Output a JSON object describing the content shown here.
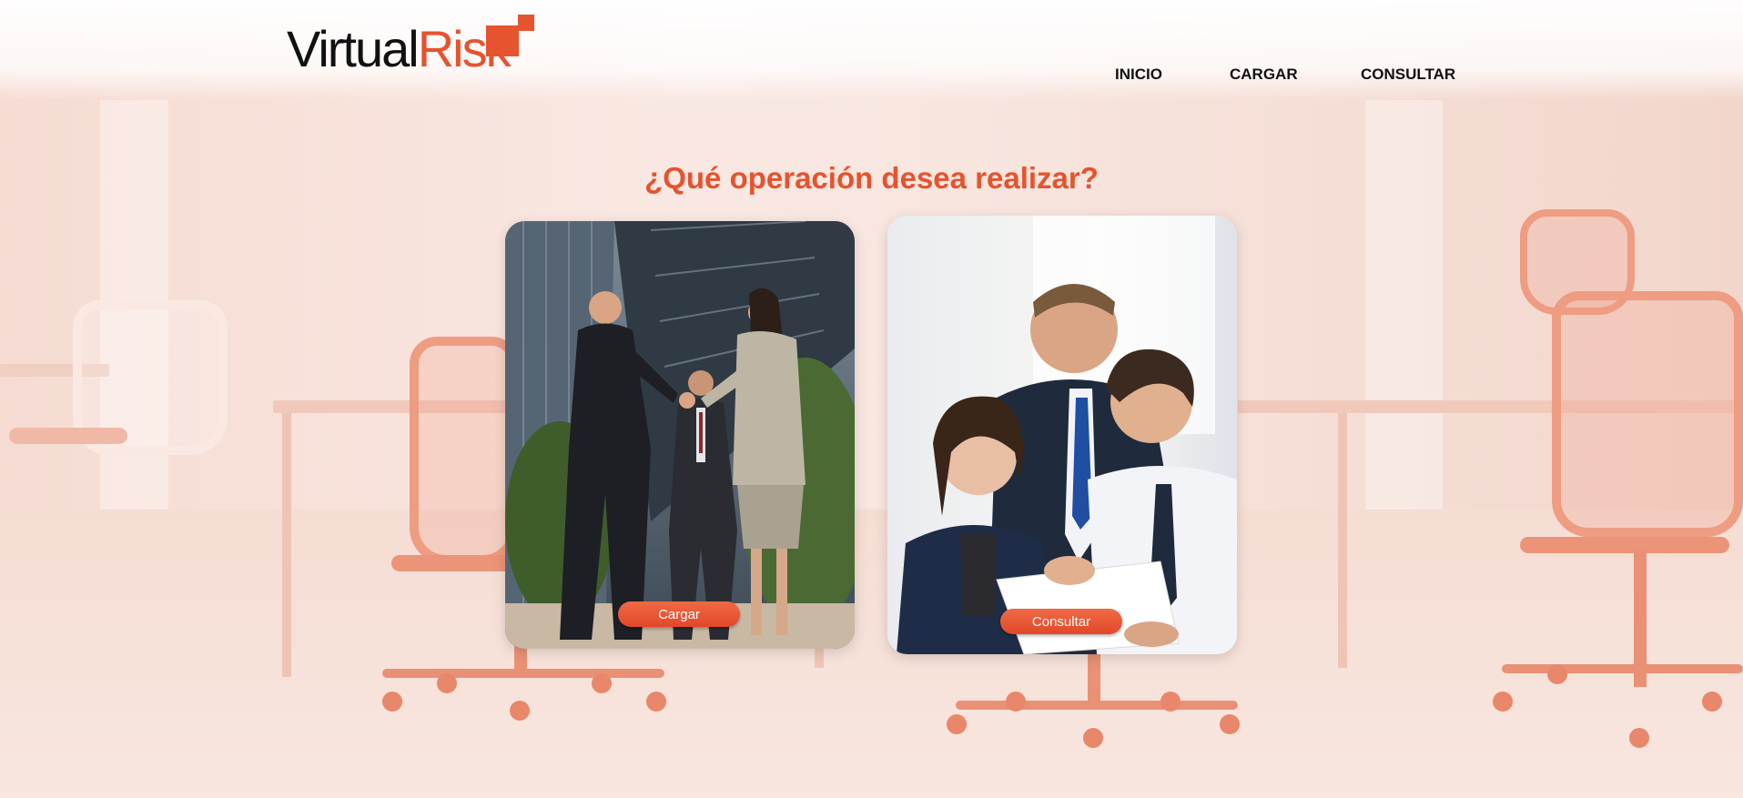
{
  "brand": {
    "name_part1": "Virtual",
    "name_part2": "Risk",
    "accent_color": "#e5532f"
  },
  "nav": {
    "items": [
      {
        "label": "INICIO"
      },
      {
        "label": "CARGAR"
      },
      {
        "label": "CONSULTAR"
      }
    ]
  },
  "main": {
    "title": "¿Qué operación desea realizar?",
    "cards": [
      {
        "button_label": "Cargar",
        "image": "business-handshake-photo"
      },
      {
        "button_label": "Consultar",
        "image": "team-reviewing-document-photo"
      }
    ]
  }
}
